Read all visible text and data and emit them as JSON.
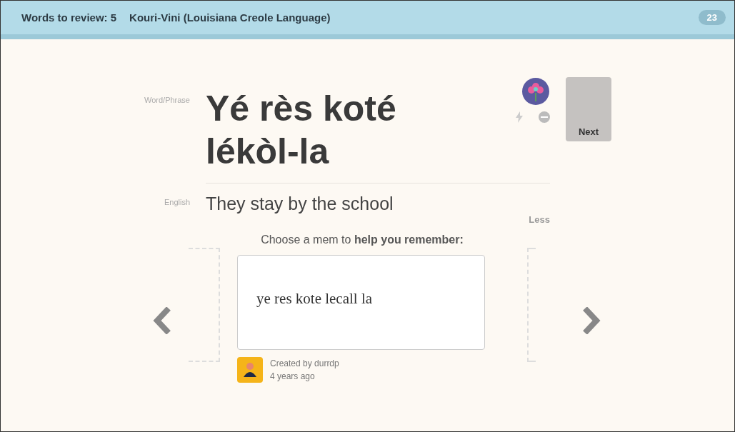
{
  "header": {
    "review_label": "Words to review: 5",
    "course": "Kouri-Vini (Louisiana Creole Language)",
    "count": "23"
  },
  "word": {
    "label": "Word/Phrase",
    "text": "Yé rès koté lékòl-la"
  },
  "english": {
    "label": "English",
    "text": "They stay by the school"
  },
  "next_button": "Next",
  "less_link": "Less",
  "mems": {
    "prompt": "Choose a mem to **help you remember:**",
    "text": "ye res kote lecall la",
    "creator": "Created by durrdp",
    "age": "4 years ago"
  }
}
